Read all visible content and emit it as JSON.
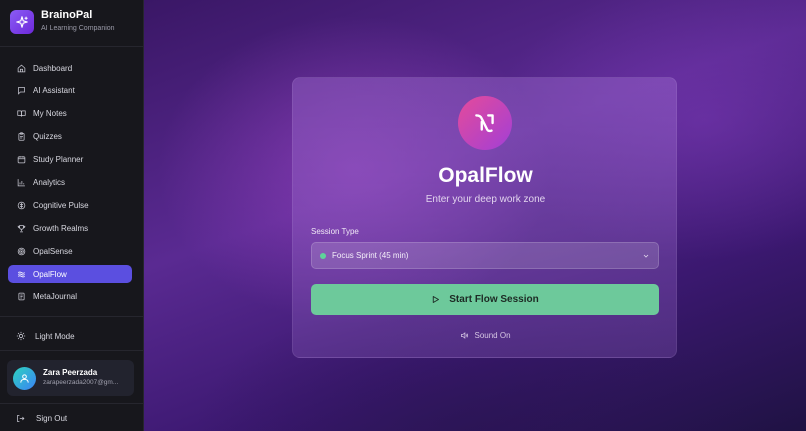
{
  "brand": {
    "title": "BrainoPal",
    "subtitle": "AI Learning Companion",
    "icon": "sparkles-icon"
  },
  "sidebar": {
    "items": [
      {
        "label": "Dashboard",
        "icon": "home-icon",
        "active": false
      },
      {
        "label": "AI Assistant",
        "icon": "chat-icon",
        "active": false
      },
      {
        "label": "My Notes",
        "icon": "book-icon",
        "active": false
      },
      {
        "label": "Quizzes",
        "icon": "clipboard-icon",
        "active": false
      },
      {
        "label": "Study Planner",
        "icon": "calendar-icon",
        "active": false
      },
      {
        "label": "Analytics",
        "icon": "bar-chart-icon",
        "active": false
      },
      {
        "label": "Cognitive Pulse",
        "icon": "brain-icon",
        "active": false
      },
      {
        "label": "Growth Realms",
        "icon": "trophy-icon",
        "active": false
      },
      {
        "label": "OpalSense",
        "icon": "target-icon",
        "active": false
      },
      {
        "label": "OpalFlow",
        "icon": "waves-icon",
        "active": true
      },
      {
        "label": "MetaJournal",
        "icon": "journal-icon",
        "active": false
      }
    ],
    "light_mode_label": "Light Mode",
    "signout_label": "Sign Out"
  },
  "user": {
    "name": "Zara Peerzada",
    "email": "zarapeerzada2007@gm..."
  },
  "card": {
    "title": "OpalFlow",
    "subtitle": "Enter your deep work zone",
    "session_label": "Session Type",
    "session_value": "Focus Sprint (45 min)",
    "start_label": "Start Flow Session",
    "sound_label": "Sound On"
  },
  "colors": {
    "accent": "#5b4fe0",
    "start_button": "#6dc99b",
    "status_dot": "#5ed39a"
  }
}
